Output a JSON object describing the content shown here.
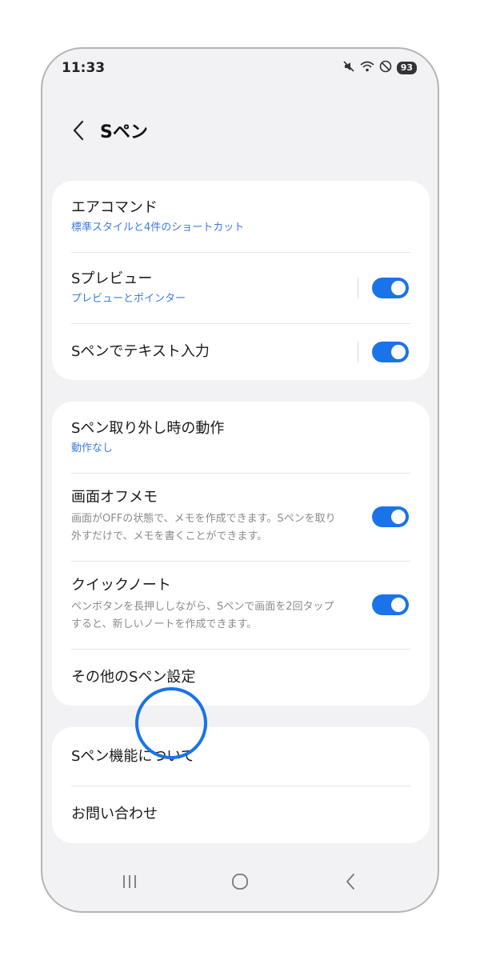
{
  "status_bar": {
    "time": "11:33",
    "battery": "93"
  },
  "header": {
    "title": "Sペン"
  },
  "group1": [
    {
      "title": "エアコマンド",
      "subtitle": "標準スタイルと4件のショートカット"
    },
    {
      "title": "Sプレビュー",
      "subtitle": "プレビューとポインター",
      "toggle": true
    },
    {
      "title": "Sペンでテキスト入力",
      "toggle": true
    }
  ],
  "group2": [
    {
      "title": "Sペン取り外し時の動作",
      "subtitle": "動作なし"
    },
    {
      "title": "画面オフメモ",
      "description": "画面がOFFの状態で、メモを作成できます。Sペンを取り外すだけで、メモを書くことができます。",
      "toggle": true
    },
    {
      "title": "クイックノート",
      "description": "ペンボタンを長押ししながら、Sペンで画面を2回タップすると、新しいノートを作成できます。",
      "toggle": true
    },
    {
      "title": "その他のSペン設定"
    }
  ],
  "group3": [
    {
      "title": "Sペン機能について"
    },
    {
      "title": "お問い合わせ"
    }
  ],
  "colors": {
    "accent": "#1a73e8",
    "link": "#3e7bd9",
    "background": "#f2f2f4"
  }
}
